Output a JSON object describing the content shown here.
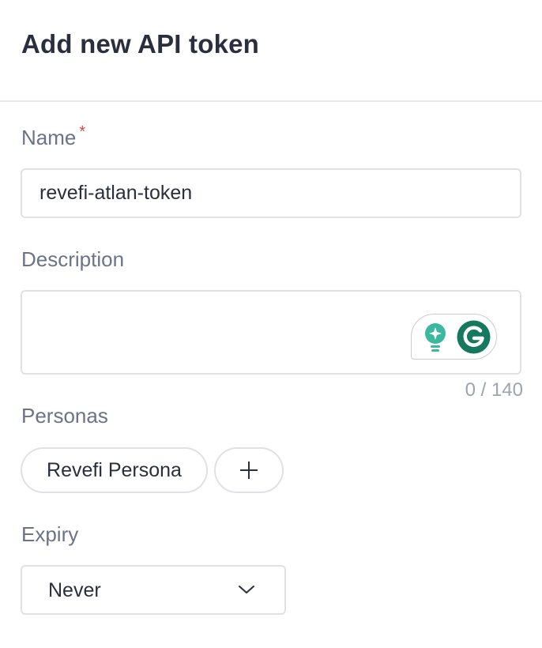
{
  "dialog": {
    "title": "Add new API token"
  },
  "fields": {
    "name": {
      "label": "Name",
      "required_marker": "*",
      "value": "revefi-atlan-token"
    },
    "description": {
      "label": "Description",
      "value": "",
      "counter": "0 / 140"
    },
    "personas": {
      "label": "Personas",
      "items": [
        "Revefi Persona"
      ],
      "add_icon": "plus-icon"
    },
    "expiry": {
      "label": "Expiry",
      "selected": "Never",
      "dropdown_icon": "chevron-down-icon"
    }
  },
  "grammarly": {
    "icons": [
      "lightbulb-icon",
      "grammarly-g-icon"
    ],
    "colors": {
      "bulb": "#3bb8a0",
      "logo": "#15795f"
    }
  },
  "colors": {
    "title": "#2a2e3f",
    "label": "#6b738a",
    "required": "#d64545",
    "border": "#dfe1e6"
  }
}
